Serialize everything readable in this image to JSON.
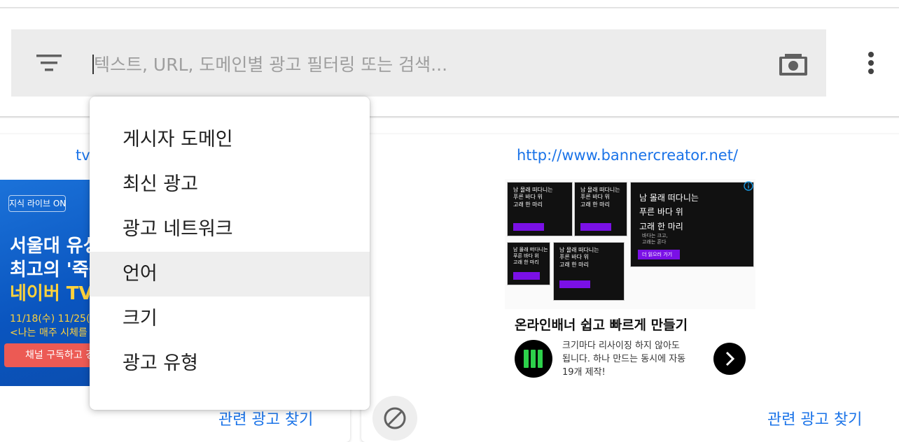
{
  "search": {
    "placeholder": "텍스트, URL, 도메인별 광고 필터링 또는 검색..."
  },
  "icons": {
    "filter": "filter-list-icon",
    "camera": "camera-icon",
    "more": "more-vertical-icon",
    "block": "block-icon",
    "info": "info-icon",
    "arrow": "chevron-right-icon"
  },
  "colors": {
    "link": "#1a73e8",
    "menu_active_bg": "#eeeeee",
    "searchbar_bg": "#ececec"
  },
  "filter_menu": {
    "items": [
      {
        "label": "게시자 도메인",
        "active": false
      },
      {
        "label": "최신 광고",
        "active": false
      },
      {
        "label": "광고 네트워크",
        "active": false
      },
      {
        "label": "언어",
        "active": true
      },
      {
        "label": "크기",
        "active": false
      },
      {
        "label": "광고 유형",
        "active": false
      }
    ]
  },
  "cards": {
    "left": {
      "url": "tv",
      "banner": {
        "logo": "지식 라이브 ON",
        "line1": "서울대 유성",
        "line2": "최고의 '죽음",
        "line3": "네이버 TV",
        "date": "11/18(수) 11/25(",
        "sub": "<나는 매주 시체를",
        "button": "채널 구독하고 경"
      },
      "related": "관련 광고 찾기"
    },
    "right": {
      "url": "http://www.bannercreator.net/",
      "preview": {
        "line1": "남 몰래 떠다니는",
        "line2": "푸른 바다 위",
        "line3": "고래 한 마리",
        "small1": "바다는 크고,",
        "small2": "고래는 혼다",
        "button": "더 읽으러 가기"
      },
      "title": "온라인배너 쉽고 빠르게 만들기",
      "description": "크기마다 리사이징 하지 않아도 됩니다. 하나 만드는 동시에 자동 19개 제작!",
      "related": "관련 광고 찾기"
    }
  }
}
